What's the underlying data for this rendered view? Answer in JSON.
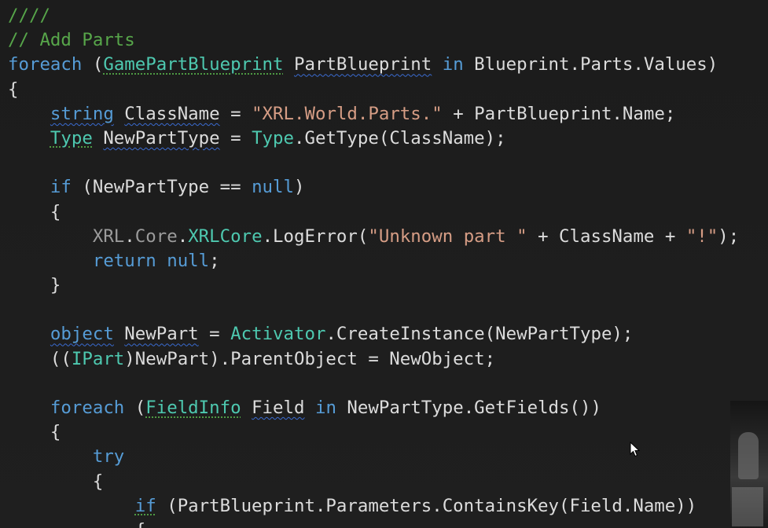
{
  "editor": {
    "lines": [
      [
        {
          "t": "////",
          "c": "comment"
        }
      ],
      [
        {
          "t": "// Add Parts",
          "c": "comment"
        }
      ],
      [
        {
          "t": "foreach",
          "c": "keyword"
        },
        {
          "t": " (",
          "c": "plain"
        },
        {
          "t": "GamePartBlueprint",
          "c": "type",
          "u": "green"
        },
        {
          "t": " ",
          "c": "plain"
        },
        {
          "t": "PartBlueprint",
          "c": "plain",
          "u": "blue"
        },
        {
          "t": " ",
          "c": "plain"
        },
        {
          "t": "in",
          "c": "keyword"
        },
        {
          "t": " Blueprint.Parts.Values)",
          "c": "plain"
        }
      ],
      [
        {
          "t": "{",
          "c": "plain"
        }
      ],
      [
        {
          "t": "    ",
          "c": "plain"
        },
        {
          "t": "string",
          "c": "keyword",
          "u": "blue"
        },
        {
          "t": " ",
          "c": "plain"
        },
        {
          "t": "ClassName",
          "c": "plain",
          "u": "blue"
        },
        {
          "t": " = ",
          "c": "plain"
        },
        {
          "t": "\"XRL.World.Parts.\"",
          "c": "string"
        },
        {
          "t": " + PartBlueprint.Name;",
          "c": "plain"
        }
      ],
      [
        {
          "t": "    ",
          "c": "plain"
        },
        {
          "t": "Type",
          "c": "type",
          "u": "green"
        },
        {
          "t": " ",
          "c": "plain"
        },
        {
          "t": "NewPartType",
          "c": "plain",
          "u": "blue"
        },
        {
          "t": " = ",
          "c": "plain"
        },
        {
          "t": "Type",
          "c": "type"
        },
        {
          "t": ".GetType(ClassName);",
          "c": "plain"
        }
      ],
      [],
      [
        {
          "t": "    ",
          "c": "plain"
        },
        {
          "t": "if",
          "c": "keyword"
        },
        {
          "t": " (NewPartType == ",
          "c": "plain"
        },
        {
          "t": "null",
          "c": "keyword"
        },
        {
          "t": ")",
          "c": "plain"
        }
      ],
      [
        {
          "t": "    {",
          "c": "plain"
        }
      ],
      [
        {
          "t": "        ",
          "c": "plain"
        },
        {
          "t": "XRL",
          "c": "dim"
        },
        {
          "t": ".",
          "c": "plain"
        },
        {
          "t": "Core",
          "c": "dim"
        },
        {
          "t": ".",
          "c": "plain"
        },
        {
          "t": "XRLCore",
          "c": "type"
        },
        {
          "t": ".LogError(",
          "c": "plain"
        },
        {
          "t": "\"Unknown part \"",
          "c": "string"
        },
        {
          "t": " + ClassName + ",
          "c": "plain"
        },
        {
          "t": "\"!\"",
          "c": "string"
        },
        {
          "t": ");",
          "c": "plain"
        }
      ],
      [
        {
          "t": "        ",
          "c": "plain"
        },
        {
          "t": "return",
          "c": "keyword"
        },
        {
          "t": " ",
          "c": "plain"
        },
        {
          "t": "null",
          "c": "keyword"
        },
        {
          "t": ";",
          "c": "plain"
        }
      ],
      [
        {
          "t": "    }",
          "c": "plain"
        }
      ],
      [],
      [
        {
          "t": "    ",
          "c": "plain"
        },
        {
          "t": "object",
          "c": "keyword",
          "u": "blue"
        },
        {
          "t": " ",
          "c": "plain"
        },
        {
          "t": "NewPart",
          "c": "plain",
          "u": "blue"
        },
        {
          "t": " = ",
          "c": "plain"
        },
        {
          "t": "Activator",
          "c": "type"
        },
        {
          "t": ".CreateInstance(NewPartType);",
          "c": "plain"
        }
      ],
      [
        {
          "t": "    ((",
          "c": "plain"
        },
        {
          "t": "IPart",
          "c": "type"
        },
        {
          "t": ")NewPart).ParentObject = NewObject;",
          "c": "plain"
        }
      ],
      [],
      [
        {
          "t": "    ",
          "c": "plain"
        },
        {
          "t": "foreach",
          "c": "keyword"
        },
        {
          "t": " (",
          "c": "plain"
        },
        {
          "t": "FieldInfo",
          "c": "type",
          "u": "green"
        },
        {
          "t": " ",
          "c": "plain"
        },
        {
          "t": "Field",
          "c": "plain",
          "u": "blue"
        },
        {
          "t": " ",
          "c": "plain"
        },
        {
          "t": "in",
          "c": "keyword"
        },
        {
          "t": " NewPartType.GetFields())",
          "c": "plain"
        }
      ],
      [
        {
          "t": "    {",
          "c": "plain"
        }
      ],
      [
        {
          "t": "        ",
          "c": "plain"
        },
        {
          "t": "try",
          "c": "keyword"
        }
      ],
      [
        {
          "t": "        {",
          "c": "plain"
        }
      ],
      [
        {
          "t": "            ",
          "c": "plain"
        },
        {
          "t": "if",
          "c": "keyword",
          "u": "green"
        },
        {
          "t": " (PartBlueprint.Parameters.ContainsKey(Field.Name))",
          "c": "plain"
        }
      ],
      [
        {
          "t": "            {",
          "c": "plain"
        }
      ]
    ]
  }
}
